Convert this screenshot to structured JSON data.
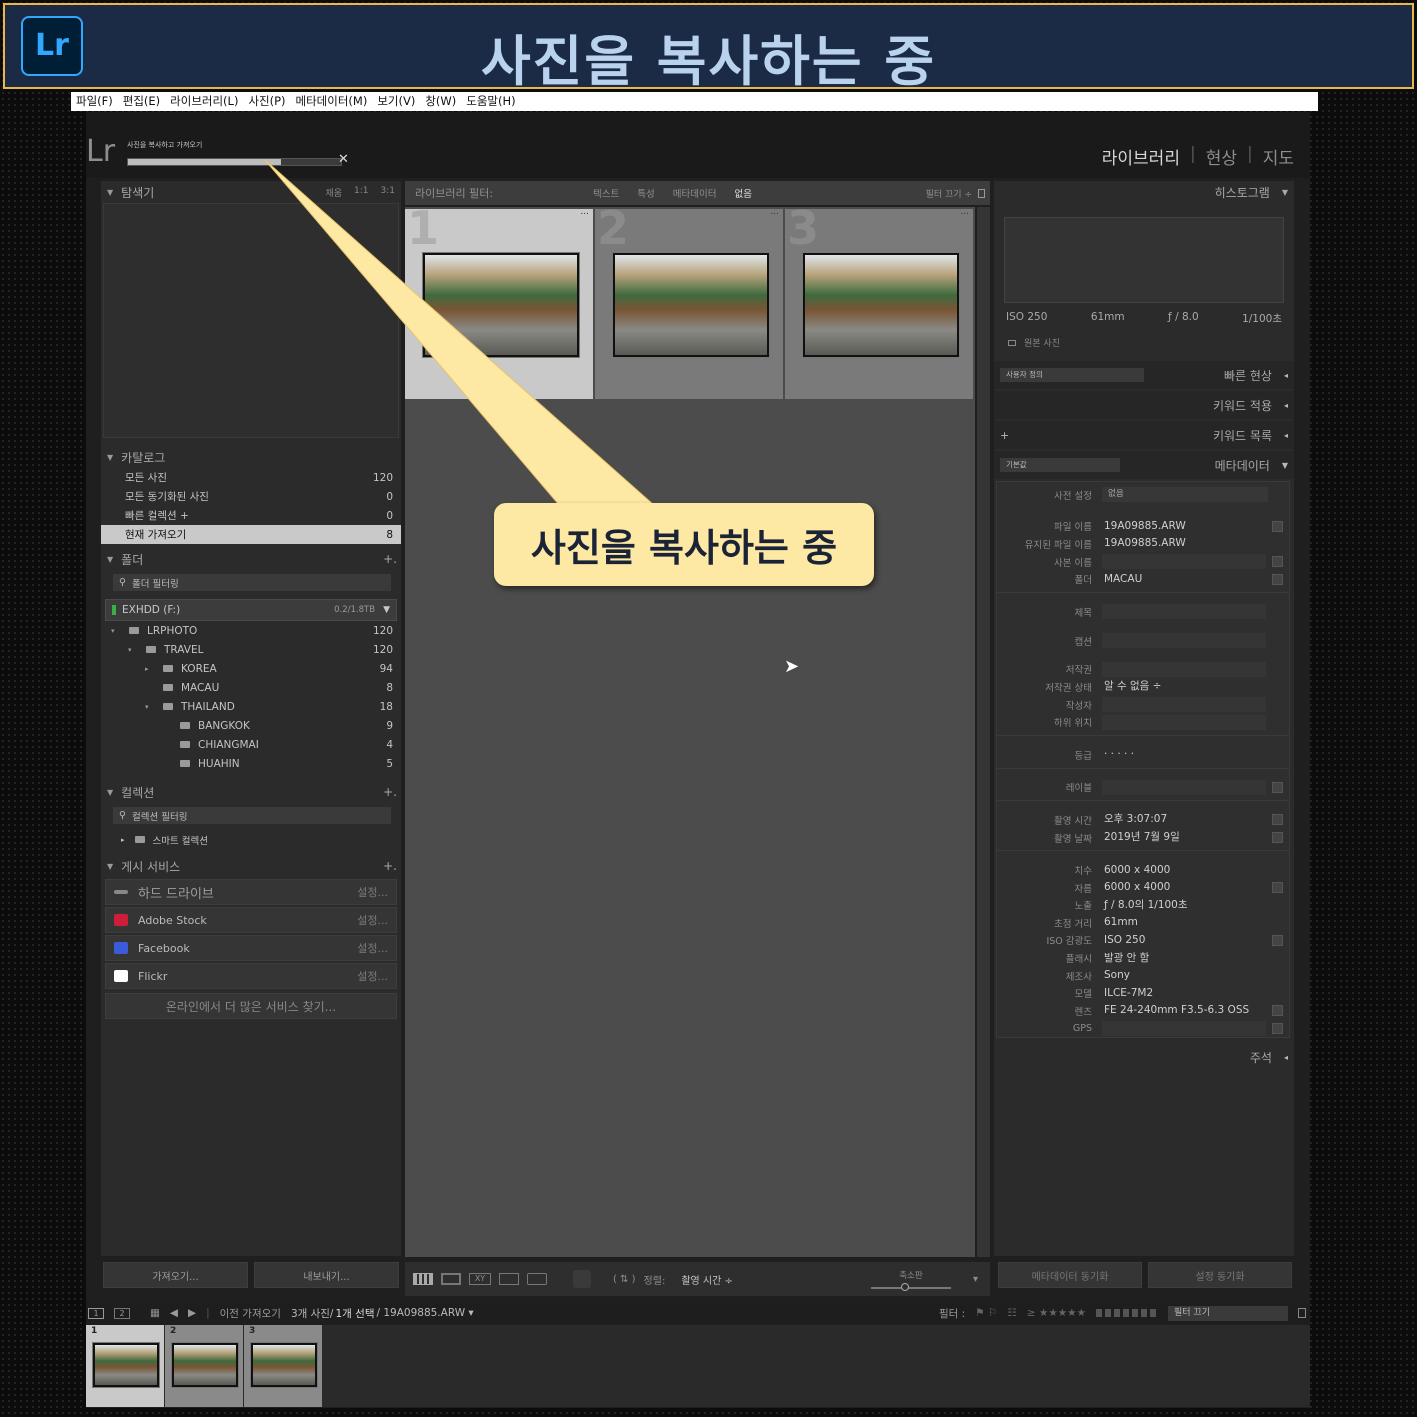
{
  "banner": {
    "logo": "Lr",
    "title": "사진을 복사하는 중"
  },
  "menu": [
    "파일(F)",
    "편집(E)",
    "라이브러리(L)",
    "사진(P)",
    "메타데이터(M)",
    "보기(V)",
    "창(W)",
    "도움말(H)"
  ],
  "identity": {
    "logo": "Lr",
    "progress_label": "사진을 복사하고 가져오기",
    "progress_fraction": 0.72,
    "close": "✕"
  },
  "modules": {
    "library": "라이브러리",
    "develop": "현상",
    "map": "지도",
    "sep": "|"
  },
  "navigator": {
    "title": "탐색기",
    "fit": "채움",
    "one": "1:1",
    "three": "3:1"
  },
  "catalog": {
    "title": "카탈로그",
    "items": [
      {
        "label": "모든 사진",
        "count": "120"
      },
      {
        "label": "모든 동기화된 사진",
        "count": "0"
      },
      {
        "label": "빠른 컬렉션 +",
        "count": "0"
      },
      {
        "label": "현재 가져오기",
        "count": "8"
      }
    ]
  },
  "folders": {
    "title": "폴더",
    "plus": "+.",
    "filter": "폴더 필터링",
    "volume": "EXHDD (F:)",
    "volume_size": "0.2/1.8TB",
    "items": [
      {
        "label": "LRPHOTO",
        "count": "120",
        "level": 0,
        "arrow": "▾"
      },
      {
        "label": "TRAVEL",
        "count": "120",
        "level": 1,
        "arrow": "▾"
      },
      {
        "label": "KOREA",
        "count": "94",
        "level": 2,
        "arrow": "▸"
      },
      {
        "label": "MACAU",
        "count": "8",
        "level": 2,
        "arrow": ""
      },
      {
        "label": "THAILAND",
        "count": "18",
        "level": 2,
        "arrow": "▾"
      },
      {
        "label": "BANGKOK",
        "count": "9",
        "level": 3,
        "arrow": ""
      },
      {
        "label": "CHIANGMAI",
        "count": "4",
        "level": 3,
        "arrow": ""
      },
      {
        "label": "HUAHIN",
        "count": "5",
        "level": 3,
        "arrow": ""
      }
    ]
  },
  "collections": {
    "title": "컬렉션",
    "plus": "+.",
    "filter": "컬렉션 필터링",
    "smart": "스마트 컬렉션"
  },
  "publish": {
    "title": "게시 서비스",
    "plus": "+.",
    "setup": "설정...",
    "services": [
      {
        "label": "하드 드라이브",
        "icon": "hard-drive-icon"
      },
      {
        "label": "Adobe Stock",
        "icon": "adobe-stock-icon"
      },
      {
        "label": "Facebook",
        "icon": "facebook-icon"
      },
      {
        "label": "Flickr",
        "icon": "flickr-icon"
      }
    ],
    "find_more": "온라인에서 더 많은 서비스 찾기..."
  },
  "left_buttons": {
    "import": "가져오기...",
    "export": "내보내기..."
  },
  "filter_bar": {
    "label": "라이브러리 필터:",
    "text": "텍스트",
    "attribute": "특성",
    "metadata": "메타데이터",
    "none": "없음",
    "filters_off": "필터 끄기 ÷"
  },
  "grid": {
    "numbers": [
      "1",
      "2",
      "3"
    ],
    "more": "..."
  },
  "toolbar": {
    "sort_label": "정렬:",
    "sort_value": "촬영 시간 ÷",
    "thumb_label": "축소판"
  },
  "histogram": {
    "title": "히스토그램",
    "iso": "ISO 250",
    "focal": "61mm",
    "aperture": "ƒ / 8.0",
    "shutter": "1/100초",
    "original": "원본 사진"
  },
  "right_panels": {
    "quick_develop": "빠른 현상",
    "preset": "사용자 정의",
    "keywording": "키워드 적용",
    "keyword_list": "키워드 목록",
    "metadata": "메타데이터",
    "metadata_preset": "기본값",
    "comments": "주석"
  },
  "metadata": {
    "preset_label": "사전 설정",
    "preset_value": "없음",
    "file_name": {
      "label": "파일 이름",
      "value": "19A09885.ARW"
    },
    "preserved": {
      "label": "유지된 파일 이름",
      "value": "19A09885.ARW"
    },
    "copy_name": {
      "label": "사본 이름",
      "value": ""
    },
    "folder": {
      "label": "폴더",
      "value": "MACAU"
    },
    "title": {
      "label": "제목"
    },
    "caption": {
      "label": "캡션"
    },
    "copyright": {
      "label": "저작권"
    },
    "copyright_status": {
      "label": "저작권 상태",
      "value": "알 수 없음 ÷"
    },
    "creator": {
      "label": "작성자"
    },
    "sublocation": {
      "label": "하위 위치"
    },
    "rating": {
      "label": "등급",
      "value": "· · · · ·"
    },
    "label": {
      "label": "레이블"
    },
    "capture_time": {
      "label": "촬영 시간",
      "value": "오후 3:07:07"
    },
    "capture_date": {
      "label": "촬영 날짜",
      "value": "2019년 7월 9일"
    },
    "dimensions": {
      "label": "치수",
      "value": "6000 x 4000"
    },
    "cropped": {
      "label": "자름",
      "value": "6000 x 4000"
    },
    "exposure": {
      "label": "노출",
      "value": "ƒ / 8.0의 1/100초"
    },
    "focal_length": {
      "label": "초점 거리",
      "value": "61mm"
    },
    "iso": {
      "label": "ISO 감광도",
      "value": "ISO 250"
    },
    "flash": {
      "label": "플래시",
      "value": "발광 안 함"
    },
    "make": {
      "label": "제조사",
      "value": "Sony"
    },
    "model": {
      "label": "모델",
      "value": "ILCE-7M2"
    },
    "lens": {
      "label": "렌즈",
      "value": "FE 24-240mm F3.5-6.3 OSS"
    },
    "gps": {
      "label": "GPS",
      "value": ""
    }
  },
  "right_buttons": {
    "sync_metadata": "메타데이터 동기화",
    "sync_settings": "설정 동기화"
  },
  "filmstrip_bar": {
    "prev_import": "이전 가져오기",
    "count": "3개 사진/",
    "selected": "1개 선택",
    "file": "/ 19A09885.ARW ▾",
    "filter": "필터 :",
    "stars": "≥ ★★★★★",
    "filter_off": "필터 끄기",
    "page1": "1",
    "page2": "2"
  },
  "filmstrip": {
    "numbers": [
      "1",
      "2",
      "3"
    ]
  },
  "callout": {
    "text": "사진을 복사하는 중"
  }
}
